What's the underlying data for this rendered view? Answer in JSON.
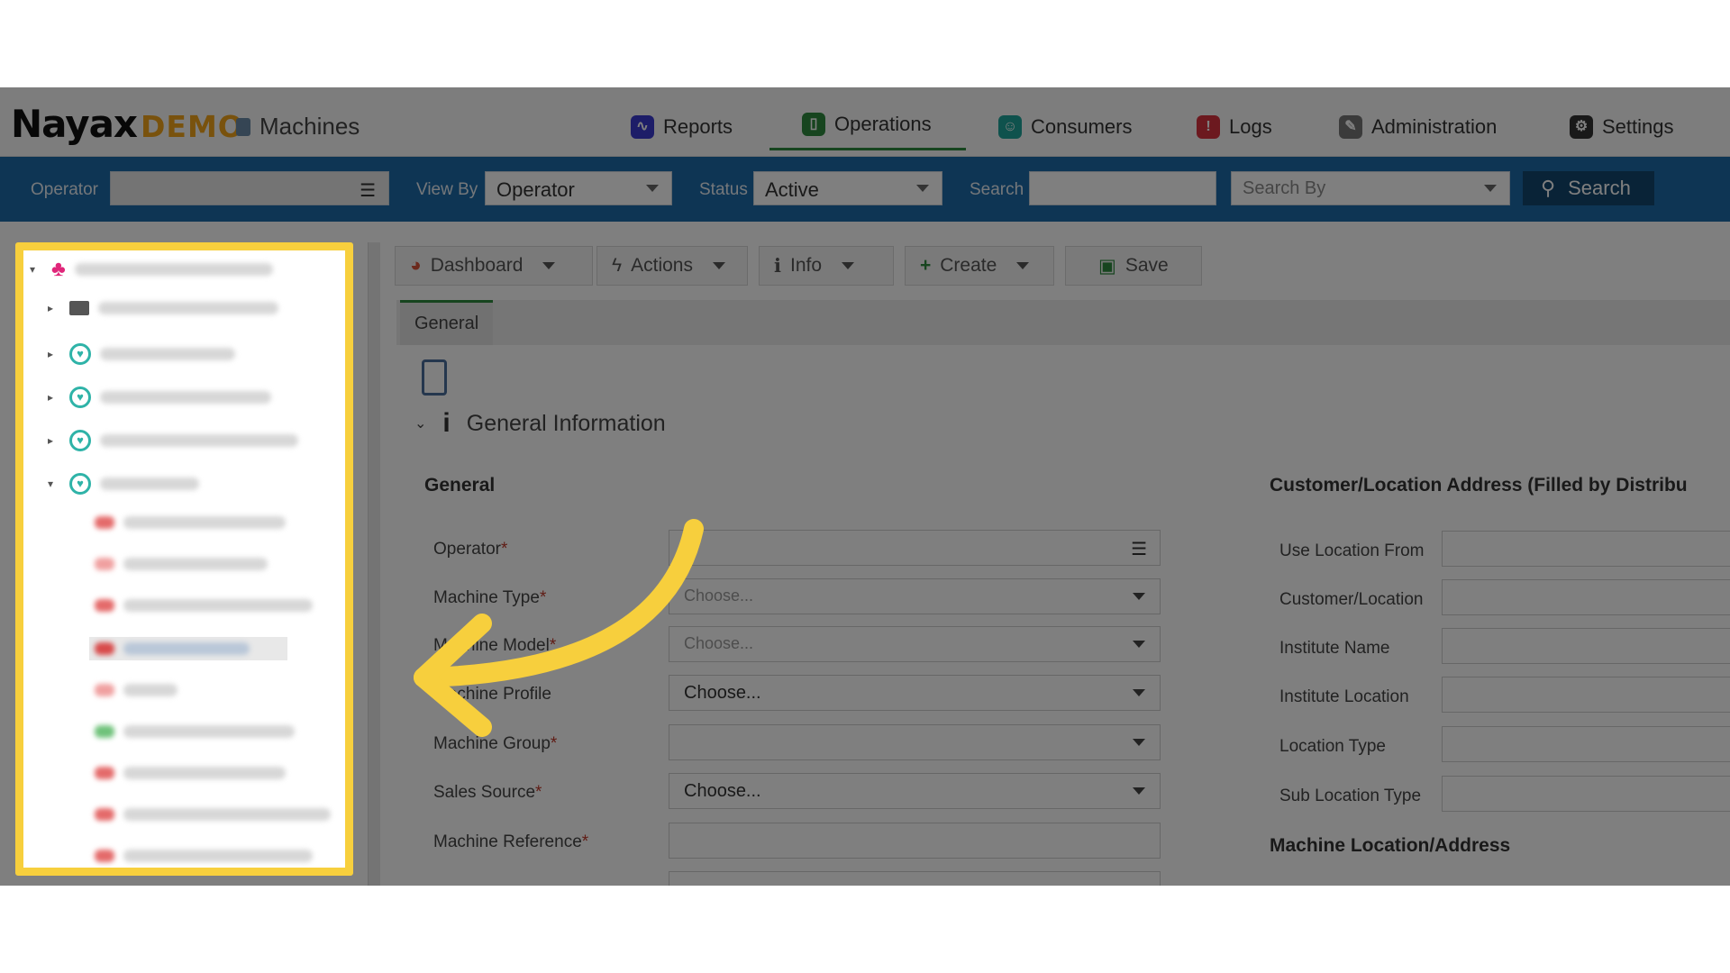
{
  "brand": {
    "name": "Nayax",
    "suffix": "DEMO"
  },
  "module": "Machines",
  "nav": [
    {
      "label": "Reports",
      "icon": "reports-icon",
      "color": "#3b3bd0"
    },
    {
      "label": "Operations",
      "icon": "operations-icon",
      "color": "#2e8b3e"
    },
    {
      "label": "Consumers",
      "icon": "consumers-icon",
      "color": "#1ea59a"
    },
    {
      "label": "Logs",
      "icon": "logs-icon",
      "color": "#d9323f"
    },
    {
      "label": "Administration",
      "icon": "administration-icon",
      "color": "#777777"
    },
    {
      "label": "Settings",
      "icon": "settings-icon",
      "color": "#333333"
    }
  ],
  "filters": {
    "operator_label": "Operator",
    "viewby_label": "View By",
    "viewby_value": "Operator",
    "status_label": "Status",
    "status_value": "Active",
    "search_label": "Search",
    "searchby_placeholder": "Search By",
    "search_button": "Search"
  },
  "toolbar": {
    "dashboard": "Dashboard",
    "actions": "Actions",
    "info": "Info",
    "create": "Create",
    "save": "Save"
  },
  "tabs": {
    "general": "General"
  },
  "section": {
    "title": "General Information"
  },
  "general": {
    "heading": "General",
    "fields": [
      {
        "label": "Operator",
        "required": "*",
        "value": ""
      },
      {
        "label": "Machine Type",
        "required": "*",
        "value": "Choose..."
      },
      {
        "label": "Machine Model",
        "required": "*",
        "value": "Choose..."
      },
      {
        "label": "Machine Profile",
        "required": "",
        "value": "Choose..."
      },
      {
        "label": "Machine Group",
        "required": "*",
        "value": ""
      },
      {
        "label": "Sales Source",
        "required": "*",
        "value": "Choose..."
      },
      {
        "label": "Machine Reference",
        "required": "*",
        "value": ""
      }
    ]
  },
  "customer": {
    "heading": "Customer/Location Address (Filled by Distribu",
    "fields": [
      "Use Location From",
      "Customer/Location",
      "Institute Name",
      "Institute Location",
      "Location Type",
      "Sub Location Type"
    ],
    "machine_location_heading": "Machine Location/Address"
  },
  "colors": {
    "filterbar": "#1c6aa8",
    "highlight": "#f7cf3d",
    "accent": "#2e8b3e"
  }
}
